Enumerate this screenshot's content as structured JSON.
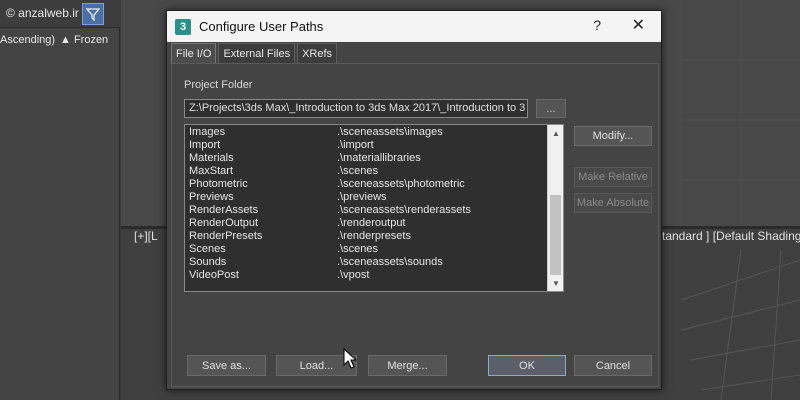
{
  "background": {
    "watermark": "© anzalweb.ir",
    "sort_label": "Ascending)",
    "frozen_label": "▲ Frozen",
    "viewport_label_left": "[+][L",
    "viewport_label_right": "tandard ] [Default Shading"
  },
  "dialog": {
    "title": "Configure User Paths",
    "icon_glyph": "3",
    "help_glyph": "?",
    "close_glyph": "✕",
    "tabs": [
      {
        "label": "File I/O",
        "active": true
      },
      {
        "label": "External Files",
        "active": false
      },
      {
        "label": "XRefs",
        "active": false
      }
    ],
    "project_folder_label": "Project Folder",
    "project_folder_value": "Z:\\Projects\\3ds Max\\_Introduction to 3ds Max 2017\\_Introduction to 3",
    "browse_label": "...",
    "paths": [
      {
        "name": "Images",
        "path": ".\\sceneassets\\images"
      },
      {
        "name": "Import",
        "path": ".\\import"
      },
      {
        "name": "Materials",
        "path": ".\\materiallibraries"
      },
      {
        "name": "MaxStart",
        "path": ".\\scenes"
      },
      {
        "name": "Photometric",
        "path": ".\\sceneassets\\photometric"
      },
      {
        "name": "Previews",
        "path": ".\\previews"
      },
      {
        "name": "RenderAssets",
        "path": ".\\sceneassets\\renderassets"
      },
      {
        "name": "RenderOutput",
        "path": ".\\renderoutput"
      },
      {
        "name": "RenderPresets",
        "path": ".\\renderpresets"
      },
      {
        "name": "Scenes",
        "path": ".\\scenes"
      },
      {
        "name": "Sounds",
        "path": ".\\sceneassets\\sounds"
      },
      {
        "name": "VideoPost",
        "path": ".\\vpost"
      }
    ],
    "modify_label": "Modify...",
    "make_relative_label": "Make Relative",
    "make_absolute_label": "Make Absolute",
    "save_as_label": "Save as...",
    "load_label": "Load...",
    "merge_label": "Merge...",
    "ok_label": "OK",
    "cancel_label": "Cancel"
  }
}
